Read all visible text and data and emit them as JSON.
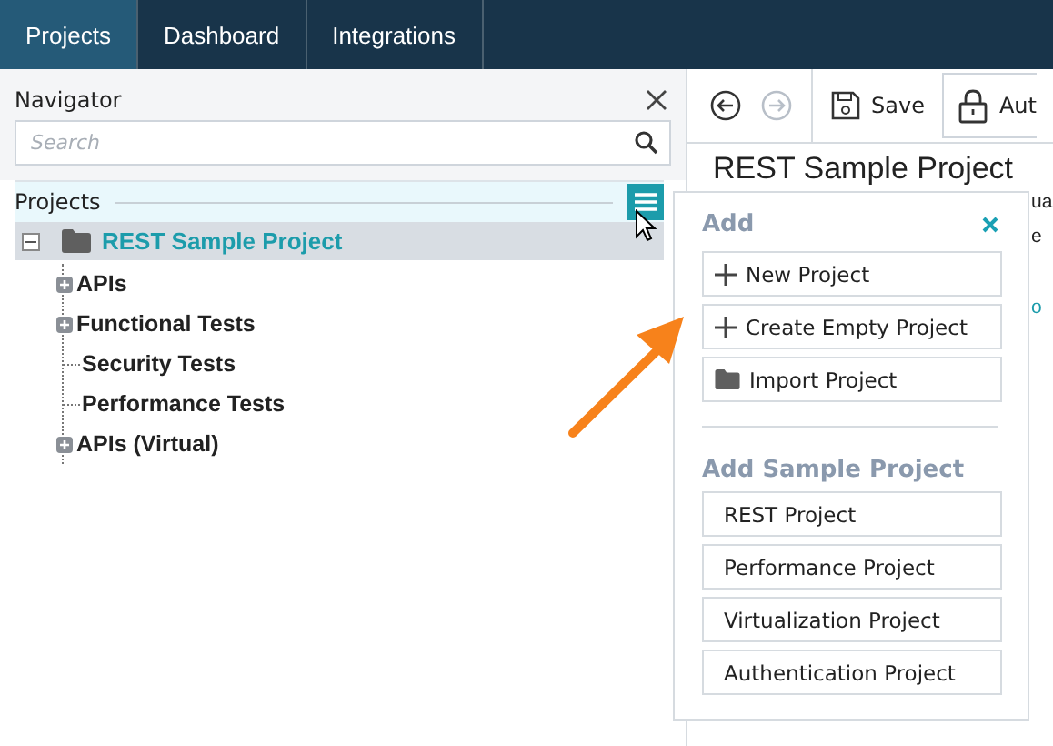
{
  "tabs": [
    {
      "label": "Projects",
      "selected": true
    },
    {
      "label": "Dashboard",
      "selected": false
    },
    {
      "label": "Integrations",
      "selected": false
    }
  ],
  "navigator": {
    "title": "Navigator",
    "search": {
      "placeholder": "Search"
    },
    "section": "Projects",
    "tree": [
      {
        "label": "REST Sample Project",
        "selected": true,
        "expanded": true,
        "children": [
          {
            "label": "APIs",
            "expandable": true
          },
          {
            "label": "Functional Tests",
            "expandable": true
          },
          {
            "label": "Security Tests",
            "expandable": false
          },
          {
            "label": "Performance Tests",
            "expandable": false
          },
          {
            "label": "APIs (Virtual)",
            "expandable": true
          }
        ]
      }
    ]
  },
  "toolbar": {
    "save": "Save",
    "auth": "Aut"
  },
  "content": {
    "title": "REST Sample Project",
    "fragments": [
      "ua",
      "e",
      "o"
    ]
  },
  "add_menu": {
    "title": "Add",
    "actions": [
      {
        "label": "New Project",
        "kind": "plus"
      },
      {
        "label": "Create Empty Project",
        "kind": "plus"
      },
      {
        "label": "Import Project",
        "kind": "folder"
      }
    ],
    "sample_title": "Add Sample Project",
    "samples": [
      "REST Project",
      "Performance Project",
      "Virtualization Project",
      "Authentication Project"
    ]
  }
}
